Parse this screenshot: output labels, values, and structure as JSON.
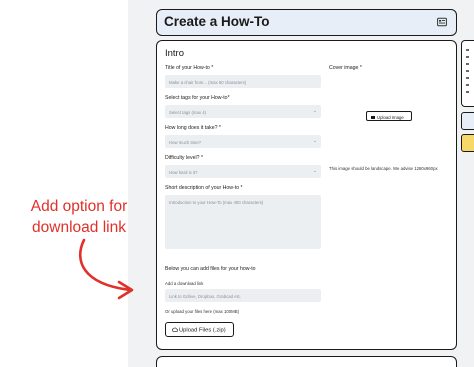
{
  "annotation": {
    "text": "Add option for download link",
    "color": "#e0302a"
  },
  "header": {
    "title": "Create a How-To",
    "icon": "image-icon"
  },
  "form": {
    "section_title": "Intro",
    "title_field": {
      "label": "Title of your How-to *",
      "placeholder": "Make a chair from... (max 50 characters)"
    },
    "tags_field": {
      "label": "Select tags for your How-to*",
      "placeholder": "Select tags (max 4)"
    },
    "time_field": {
      "label": "How long does it take? *",
      "placeholder": "How much time?"
    },
    "difficulty_field": {
      "label": "Difficulty level? *",
      "placeholder": "How hard is it?"
    },
    "description_field": {
      "label": "Short description of your How-to *",
      "placeholder": "Introduction to your How-To (max 400 characters)"
    },
    "cover": {
      "label": "Cover image *",
      "button": "Upload Image",
      "hint": "This image should be landscape. We advise 1280x960px"
    },
    "files": {
      "heading": "Below you can add files for your how-to",
      "download_label": "Add a download link",
      "download_placeholder": "Link to Gdrive, Dropbox, Grabcad etc.",
      "or_upload": "Or upload your files here (max 100MB)",
      "upload_button": "Upload Files (.zip)"
    }
  },
  "colors": {
    "page_strip": "#f1f2f3",
    "header_bg": "#e7eef7",
    "field_bg": "#eceff2",
    "accent_yellow": "#f7d96a"
  }
}
